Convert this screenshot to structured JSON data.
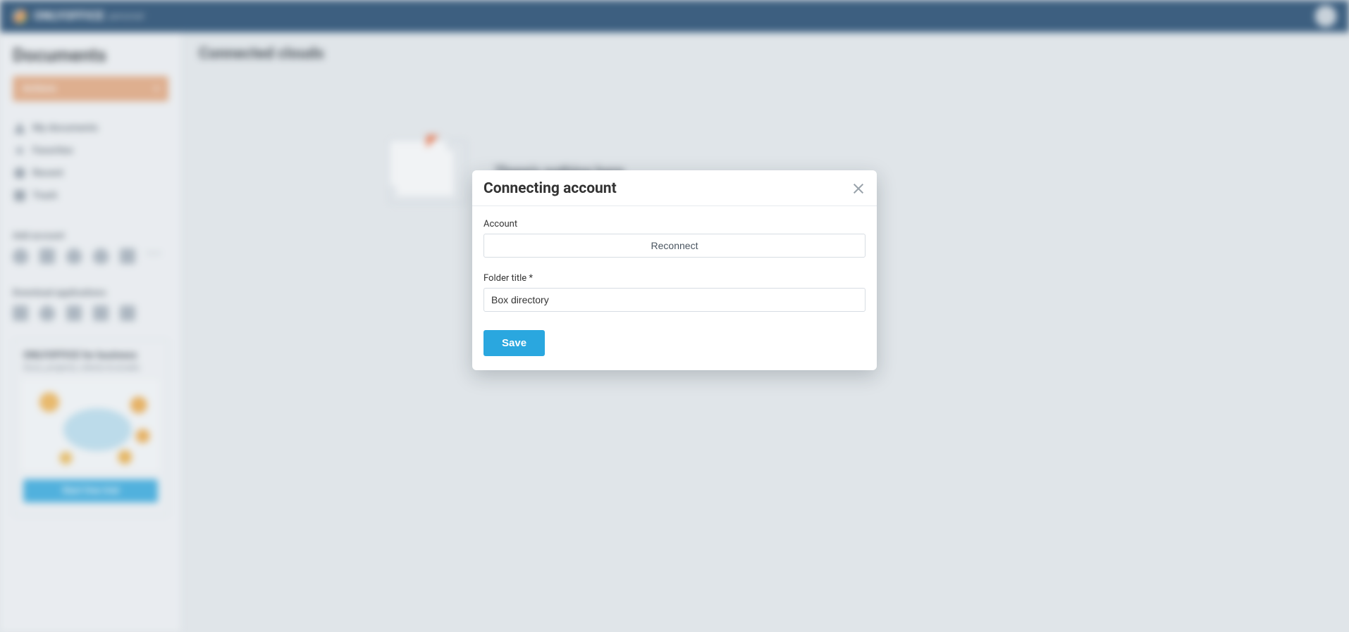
{
  "header": {
    "brand": "ONLYOFFICE",
    "brand_sub": "personal"
  },
  "sidebar": {
    "title": "Documents",
    "actions_label": "Actions",
    "nav": {
      "my_docs": "My documents",
      "favorites": "Favorites",
      "recent": "Recent",
      "trash": "Trash"
    },
    "add_account_label": "Add account",
    "download_apps_label": "Download applications",
    "promo": {
      "title": "ONLYOFFICE for business",
      "sub": "Docs, projects, clients & emails",
      "cta": "Start free trial"
    }
  },
  "main": {
    "heading": "Connected clouds",
    "empty_text": "There's nothing here"
  },
  "modal": {
    "title": "Connecting account",
    "account_label": "Account",
    "reconnect_label": "Reconnect",
    "folder_label": "Folder title *",
    "folder_value": "Box directory",
    "save_label": "Save"
  }
}
